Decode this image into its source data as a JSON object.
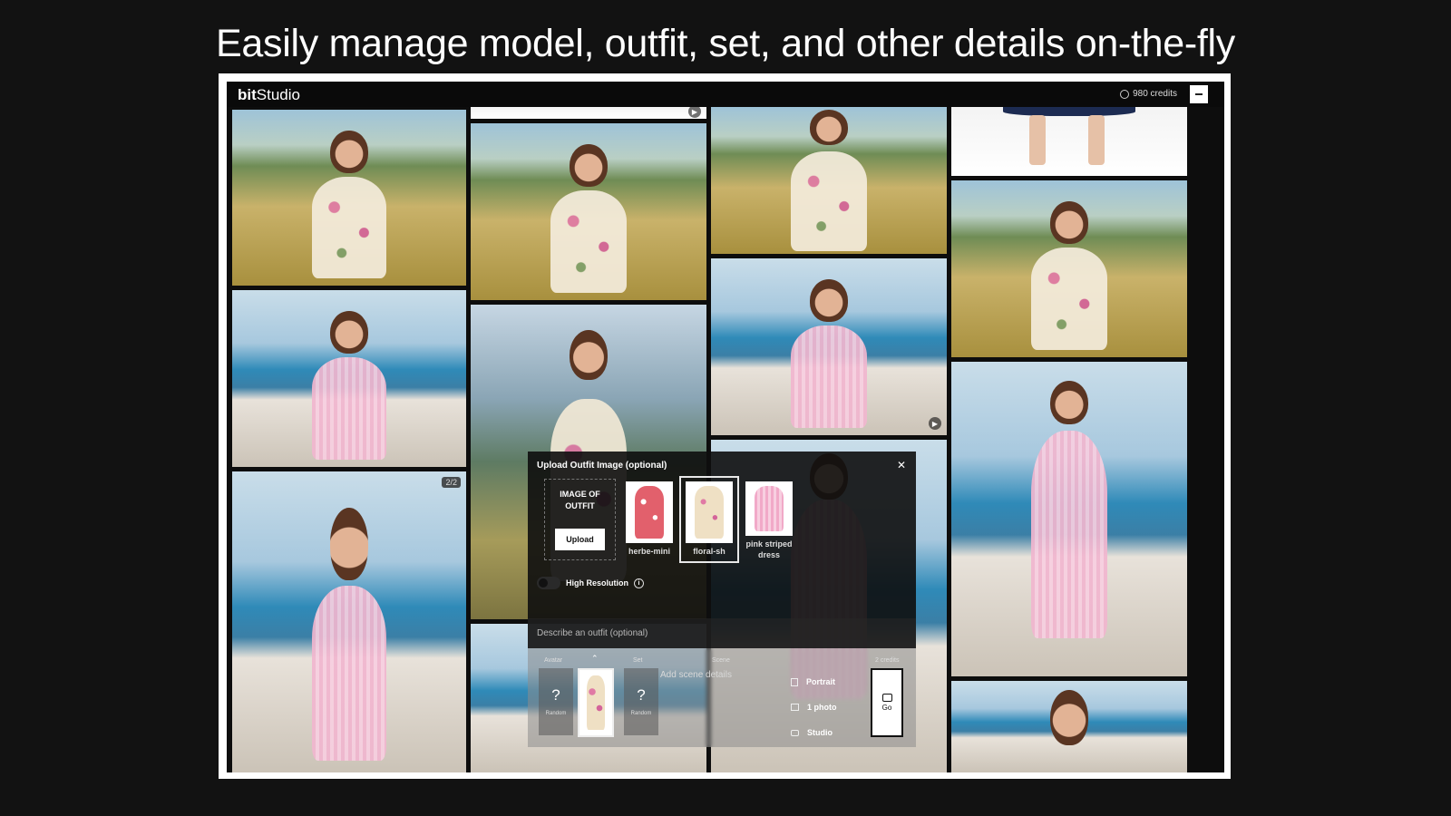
{
  "headline": "Easily manage model, outfit, set, and other details on-the-fly",
  "app": {
    "logo_bold": "bit",
    "logo_rest": "Studio",
    "credits": "980 credits"
  },
  "gallery": {
    "badge": "2/2"
  },
  "upload_panel": {
    "title": "Upload Outfit Image (optional)",
    "dropzone_label": "IMAGE OF OUTFIT",
    "upload_button": "Upload",
    "thumbs": [
      {
        "label": "herbe-mini",
        "color": "#e2606c"
      },
      {
        "label": "floral-sh",
        "color": "#efe0c4"
      },
      {
        "label": "pink striped dress",
        "color": "#f4b4cf"
      }
    ],
    "high_resolution": "High Resolution",
    "outfit_placeholder": "Describe an outfit (optional)"
  },
  "composer": {
    "avatar_label": "Avatar",
    "set_label": "Set",
    "scene_label": "Scene",
    "cost_label": "2 credits",
    "random_label": "Random",
    "question": "?",
    "scene_placeholder": "Add scene details",
    "options": {
      "orientation": "Portrait",
      "count": "1 photo",
      "style": "Studio"
    },
    "go_label": "Go"
  }
}
